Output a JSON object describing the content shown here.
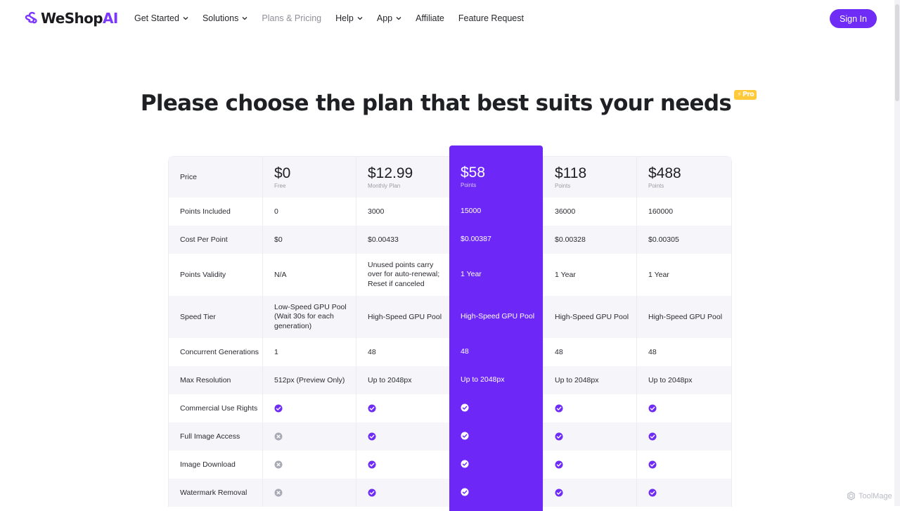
{
  "brand": {
    "name_main": "WeShop",
    "name_accent": "AI",
    "accent_color": "#7b37ff",
    "logo_icon": "weshop-logo-icon"
  },
  "nav": [
    {
      "label": "Get Started",
      "has_dropdown": true
    },
    {
      "label": "Solutions",
      "has_dropdown": true
    },
    {
      "label": "Plans & Pricing",
      "has_dropdown": false,
      "active": true
    },
    {
      "label": "Help",
      "has_dropdown": true
    },
    {
      "label": "App",
      "has_dropdown": true
    },
    {
      "label": "Affiliate",
      "has_dropdown": false
    },
    {
      "label": "Feature Request",
      "has_dropdown": false
    }
  ],
  "sign_in_label": "Sign In",
  "heading": "Please choose the plan that best suits your needs",
  "pro_badge": "Pro",
  "plans": [
    {
      "price": "$0",
      "sub": "Free"
    },
    {
      "price": "$12.99",
      "sub": "Monthly Plan"
    },
    {
      "price": "$58",
      "sub": "Points",
      "highlighted": true
    },
    {
      "price": "$118",
      "sub": "Points"
    },
    {
      "price": "$488",
      "sub": "Points"
    }
  ],
  "rows": [
    {
      "label": "Price",
      "type": "price"
    },
    {
      "label": "Points Included",
      "type": "text",
      "values": [
        "0",
        "3000",
        "15000",
        "36000",
        "160000"
      ]
    },
    {
      "label": "Cost Per Point",
      "type": "text",
      "values": [
        "$0",
        "$0.00433",
        "$0.00387",
        "$0.00328",
        "$0.00305"
      ]
    },
    {
      "label": "Points Validity",
      "type": "text",
      "values": [
        "N/A",
        "Unused points carry over for auto-renewal; Reset if canceled",
        "1 Year",
        "1 Year",
        "1 Year"
      ]
    },
    {
      "label": "Speed Tier",
      "type": "text",
      "values": [
        "Low-Speed GPU Pool (Wait 30s for each generation)",
        "High-Speed GPU Pool",
        "High-Speed GPU Pool",
        "High-Speed GPU Pool",
        "High-Speed GPU Pool"
      ]
    },
    {
      "label": "Concurrent Generations",
      "type": "text",
      "values": [
        "1",
        "48",
        "48",
        "48",
        "48"
      ]
    },
    {
      "label": "Max Resolution",
      "type": "text",
      "values": [
        "512px (Preview Only)",
        "Up to 2048px",
        "Up to 2048px",
        "Up to 2048px",
        "Up to 2048px"
      ]
    },
    {
      "label": "Commercial Use Rights",
      "type": "icon",
      "values": [
        true,
        true,
        true,
        true,
        true
      ]
    },
    {
      "label": "Full Image Access",
      "type": "icon",
      "values": [
        false,
        true,
        true,
        true,
        true
      ]
    },
    {
      "label": "Image Download",
      "type": "icon",
      "values": [
        false,
        true,
        true,
        true,
        true
      ]
    },
    {
      "label": "Watermark Removal",
      "type": "icon",
      "values": [
        false,
        true,
        true,
        true,
        true
      ]
    }
  ],
  "colors": {
    "primary": "#6d28f7",
    "check": "#6f2cf6",
    "cross": "#a8abb5",
    "row_shade": "#f6f6fa"
  },
  "watermark": "ToolMage"
}
